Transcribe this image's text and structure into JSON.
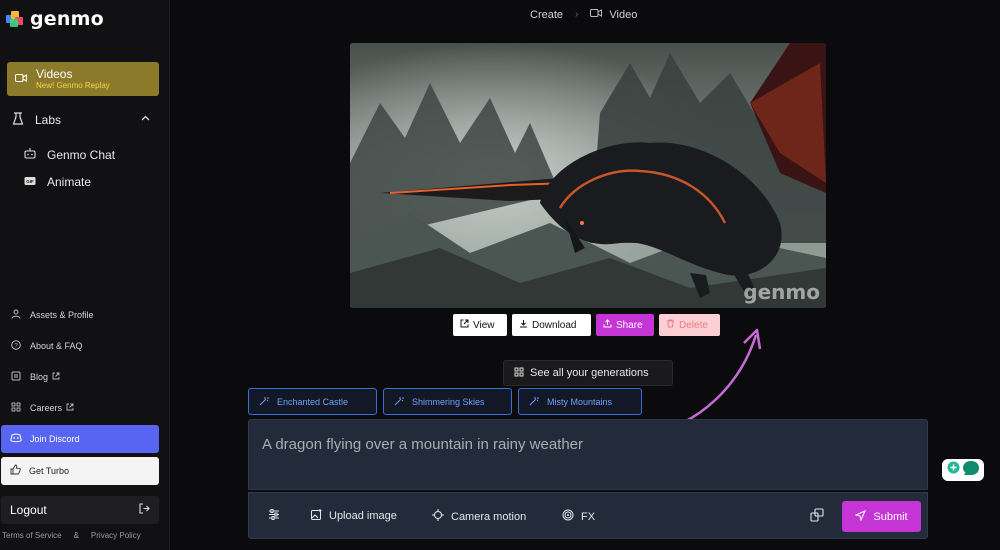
{
  "brand": {
    "name": "genmo",
    "watermark": "genmo"
  },
  "sidebar": {
    "videos": {
      "label": "Videos",
      "sublabel": "New! Genmo Replay",
      "icon": "video-icon"
    },
    "labs": {
      "label": "Labs",
      "icon": "flask-icon"
    },
    "labs_items": [
      {
        "label": "Genmo Chat",
        "icon": "chat-bot-icon"
      },
      {
        "label": "Animate",
        "icon": "gif-icon"
      }
    ],
    "links": [
      {
        "label": "Assets & Profile",
        "icon": "user-icon"
      },
      {
        "label": "About & FAQ",
        "icon": "help-circle-icon"
      },
      {
        "label": "Blog",
        "icon": "blog-icon"
      },
      {
        "label": "Careers",
        "icon": "careers-icon"
      }
    ],
    "discord": {
      "label": "Join Discord",
      "icon": "discord-icon"
    },
    "turbo": {
      "label": "Get Turbo",
      "icon": "thumbs-up-icon"
    },
    "logout": {
      "label": "Logout",
      "icon": "logout-icon"
    },
    "footer": {
      "terms": "Terms of Service",
      "separator": "&",
      "privacy": "Privacy Policy"
    }
  },
  "breadcrumb": {
    "create": "Create",
    "video": "Video"
  },
  "actions": {
    "view": "View",
    "download": "Download",
    "share": "Share",
    "delete": "Delete"
  },
  "see_all": "See all your generations",
  "suggestions": [
    "Enchanted Castle",
    "Shimmering Skies",
    "Misty Mountains"
  ],
  "prompt": {
    "value": "A dragon flying over a mountain in rainy weather"
  },
  "toolbar": {
    "upload": "Upload image",
    "camera": "Camera motion",
    "fx": "FX",
    "submit": "Submit"
  },
  "colors": {
    "accent": "#c535d6",
    "videos_nav": "#8b7a2a",
    "discord": "#5865f2",
    "chip_border": "#3b6ed8",
    "prompt_bg": "#232b3a"
  }
}
